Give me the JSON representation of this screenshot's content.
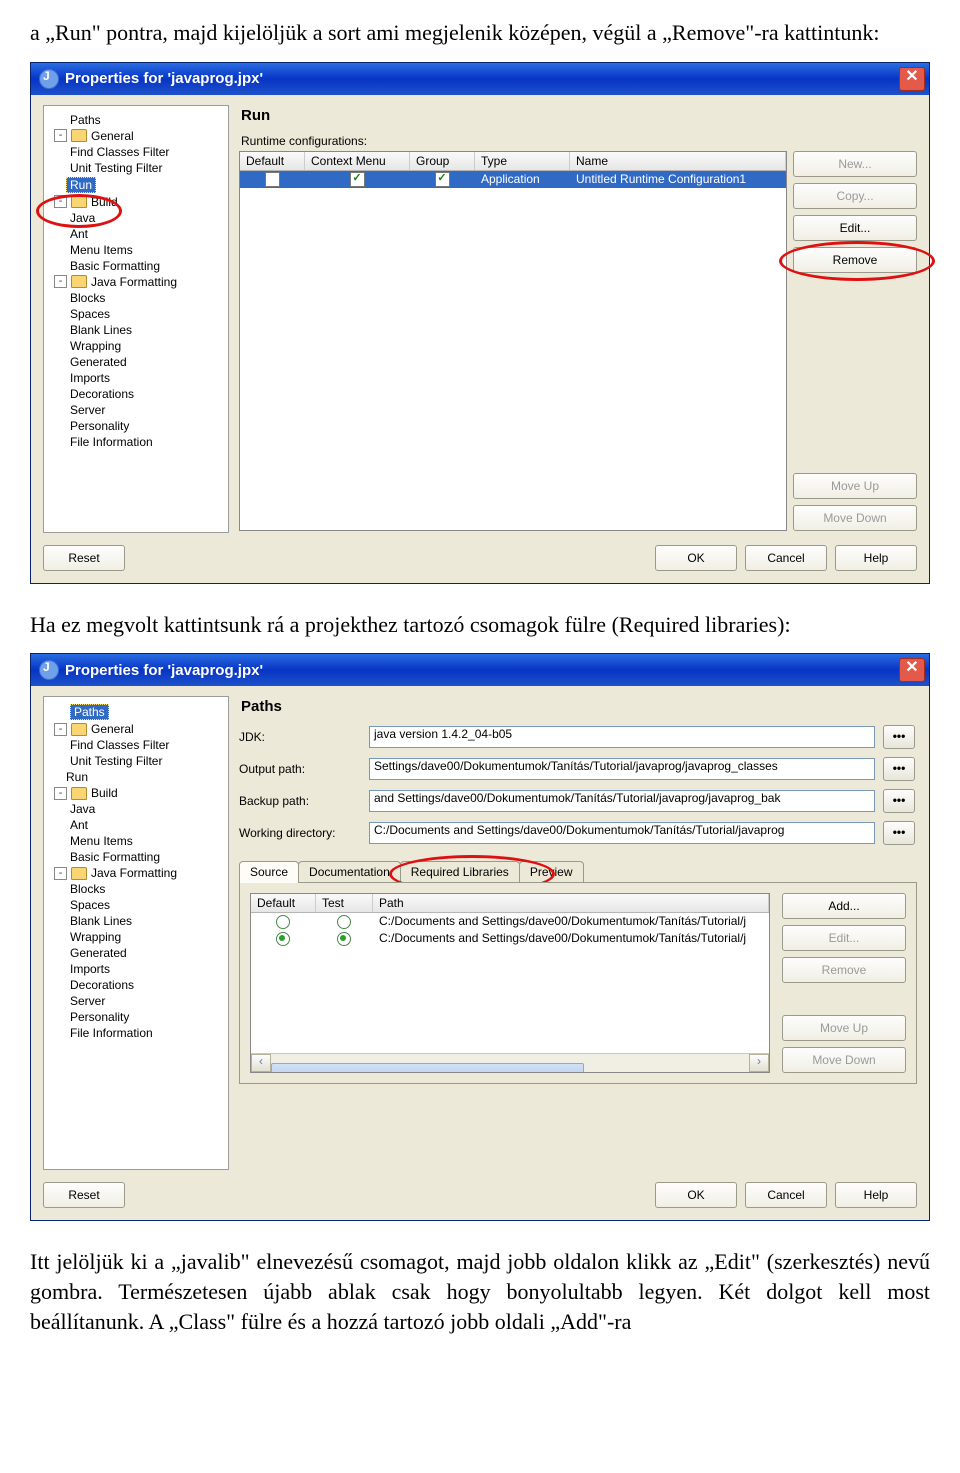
{
  "para1": "a „Run\" pontra, majd kijelöljük a sort ami megjelenik középen, végül a „Remove\"-ra kattintunk:",
  "para2": "Ha ez megvolt kattintsunk rá a projekthez tartozó csomagok fülre (Required libraries):",
  "para3": "Itt jelöljük ki a „javalib\" elnevezésű csomagot, majd jobb oldalon klikk az „Edit\" (szerkesztés) nevű gombra. Természetesen újabb ablak csak hogy bonyolultabb legyen. Két dolgot kell most beállítanunk. A „Class\" fülre és a hozzá tartozó jobb oldali „Add\"-ra",
  "dlg1": {
    "title": "Properties for 'javaprog.jpx'",
    "tree": {
      "items": [
        {
          "label": "Paths",
          "lvl": 1
        },
        {
          "label": "General",
          "lvl": 0,
          "exp": "-",
          "folder": true
        },
        {
          "label": "Find Classes Filter",
          "lvl": 1
        },
        {
          "label": "Unit Testing Filter",
          "lvl": 1
        },
        {
          "label": "Run",
          "lvl": 0,
          "selected": true
        },
        {
          "label": "Build",
          "lvl": 0,
          "exp": "-",
          "folder": true
        },
        {
          "label": "Java",
          "lvl": 1
        },
        {
          "label": "Ant",
          "lvl": 1
        },
        {
          "label": "Menu Items",
          "lvl": 1
        },
        {
          "label": "Basic Formatting",
          "lvl": 1
        },
        {
          "label": "Java Formatting",
          "lvl": 0,
          "exp": "-",
          "folder": true
        },
        {
          "label": "Blocks",
          "lvl": 1
        },
        {
          "label": "Spaces",
          "lvl": 1
        },
        {
          "label": "Blank Lines",
          "lvl": 1
        },
        {
          "label": "Wrapping",
          "lvl": 1
        },
        {
          "label": "Generated",
          "lvl": 1
        },
        {
          "label": "Imports",
          "lvl": 1
        },
        {
          "label": "Decorations",
          "lvl": 1
        },
        {
          "label": "Server",
          "lvl": 1
        },
        {
          "label": "Personality",
          "lvl": 1
        },
        {
          "label": "File Information",
          "lvl": 1
        }
      ]
    },
    "panel_title": "Run",
    "subhead": "Runtime configurations:",
    "columns": [
      "Default",
      "Context Menu",
      "Group",
      "Type",
      "Name"
    ],
    "row": {
      "default": false,
      "context": true,
      "group": true,
      "type": "Application",
      "name": "Untitled Runtime Configuration1"
    },
    "buttons": {
      "new": "New...",
      "copy": "Copy...",
      "edit": "Edit...",
      "remove": "Remove",
      "moveup": "Move Up",
      "movedown": "Move Down"
    },
    "bottom": {
      "reset": "Reset",
      "ok": "OK",
      "cancel": "Cancel",
      "help": "Help"
    }
  },
  "dlg2": {
    "title": "Properties for 'javaprog.jpx'",
    "tree": {
      "items": [
        {
          "label": "Paths",
          "lvl": 1,
          "selected": true
        },
        {
          "label": "General",
          "lvl": 0,
          "exp": "-",
          "folder": true
        },
        {
          "label": "Find Classes Filter",
          "lvl": 1
        },
        {
          "label": "Unit Testing Filter",
          "lvl": 1
        },
        {
          "label": "Run",
          "lvl": 0
        },
        {
          "label": "Build",
          "lvl": 0,
          "exp": "-",
          "folder": true
        },
        {
          "label": "Java",
          "lvl": 1
        },
        {
          "label": "Ant",
          "lvl": 1
        },
        {
          "label": "Menu Items",
          "lvl": 1
        },
        {
          "label": "Basic Formatting",
          "lvl": 1
        },
        {
          "label": "Java Formatting",
          "lvl": 0,
          "exp": "-",
          "folder": true
        },
        {
          "label": "Blocks",
          "lvl": 1
        },
        {
          "label": "Spaces",
          "lvl": 1
        },
        {
          "label": "Blank Lines",
          "lvl": 1
        },
        {
          "label": "Wrapping",
          "lvl": 1
        },
        {
          "label": "Generated",
          "lvl": 1
        },
        {
          "label": "Imports",
          "lvl": 1
        },
        {
          "label": "Decorations",
          "lvl": 1
        },
        {
          "label": "Server",
          "lvl": 1
        },
        {
          "label": "Personality",
          "lvl": 1
        },
        {
          "label": "File Information",
          "lvl": 1
        }
      ]
    },
    "panel_title": "Paths",
    "fields": {
      "jdk": {
        "label": "JDK:",
        "value": "java version 1.4.2_04-b05"
      },
      "output": {
        "label": "Output path:",
        "value": "Settings/dave00/Dokumentumok/Tanítás/Tutorial/javaprog/javaprog_classes"
      },
      "backup": {
        "label": "Backup path:",
        "value": "and Settings/dave00/Dokumentumok/Tanítás/Tutorial/javaprog/javaprog_bak"
      },
      "working": {
        "label": "Working directory:",
        "value": "C:/Documents and Settings/dave00/Dokumentumok/Tanítás/Tutorial/javaprog"
      }
    },
    "browse": "•••",
    "tabs": [
      "Source",
      "Documentation",
      "Required Libraries",
      "Preview"
    ],
    "active_tab": 0,
    "src_columns": [
      "Default",
      "Test",
      "Path"
    ],
    "src_rows": [
      {
        "default": false,
        "test": false,
        "path": "C:/Documents and Settings/dave00/Dokumentumok/Tanítás/Tutorial/j"
      },
      {
        "default": true,
        "test": true,
        "path": "C:/Documents and Settings/dave00/Dokumentumok/Tanítás/Tutorial/j"
      }
    ],
    "sidebtns": {
      "add": "Add...",
      "edit": "Edit...",
      "remove": "Remove",
      "moveup": "Move Up",
      "movedown": "Move Down"
    },
    "bottom": {
      "reset": "Reset",
      "ok": "OK",
      "cancel": "Cancel",
      "help": "Help"
    }
  }
}
